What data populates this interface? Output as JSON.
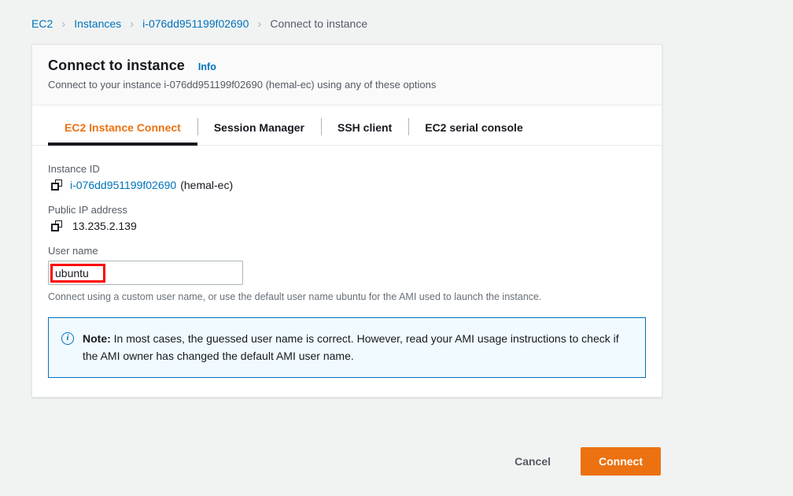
{
  "breadcrumb": {
    "items": [
      {
        "label": "EC2",
        "type": "link"
      },
      {
        "label": "Instances",
        "type": "link"
      },
      {
        "label": "i-076dd951199f02690",
        "type": "link"
      },
      {
        "label": "Connect to instance",
        "type": "current"
      }
    ],
    "separator": "›"
  },
  "card": {
    "title": "Connect to instance",
    "info_label": "Info",
    "subtitle": "Connect to your instance i-076dd951199f02690 (hemal-ec) using any of these options"
  },
  "tabs": [
    {
      "label": "EC2 Instance Connect",
      "active": true
    },
    {
      "label": "Session Manager",
      "active": false
    },
    {
      "label": "SSH client",
      "active": false
    },
    {
      "label": "EC2 serial console",
      "active": false
    }
  ],
  "fields": {
    "instance_id": {
      "label": "Instance ID",
      "value": "i-076dd951199f02690",
      "suffix": "(hemal-ec)",
      "copy_icon": "copy-icon"
    },
    "public_ip": {
      "label": "Public IP address",
      "value": "13.235.2.139",
      "copy_icon": "copy-icon"
    },
    "user_name": {
      "label": "User name",
      "value": "ubuntu",
      "placeholder": "",
      "helper": "Connect using a custom user name, or use the default user name ubuntu for the AMI used to launch the instance."
    }
  },
  "note": {
    "icon": "info-circle-icon",
    "prefix": "Note:",
    "text": " In most cases, the guessed user name is correct. However, read your AMI usage instructions to check if the AMI owner has changed the default AMI user name."
  },
  "footer": {
    "cancel_label": "Cancel",
    "connect_label": "Connect"
  },
  "colors": {
    "accent_orange": "#ec7211",
    "link_blue": "#0073bb",
    "page_background": "#f1f3f3",
    "annotation_red": "#ff0000",
    "active_tab_underline": "#16191f"
  }
}
